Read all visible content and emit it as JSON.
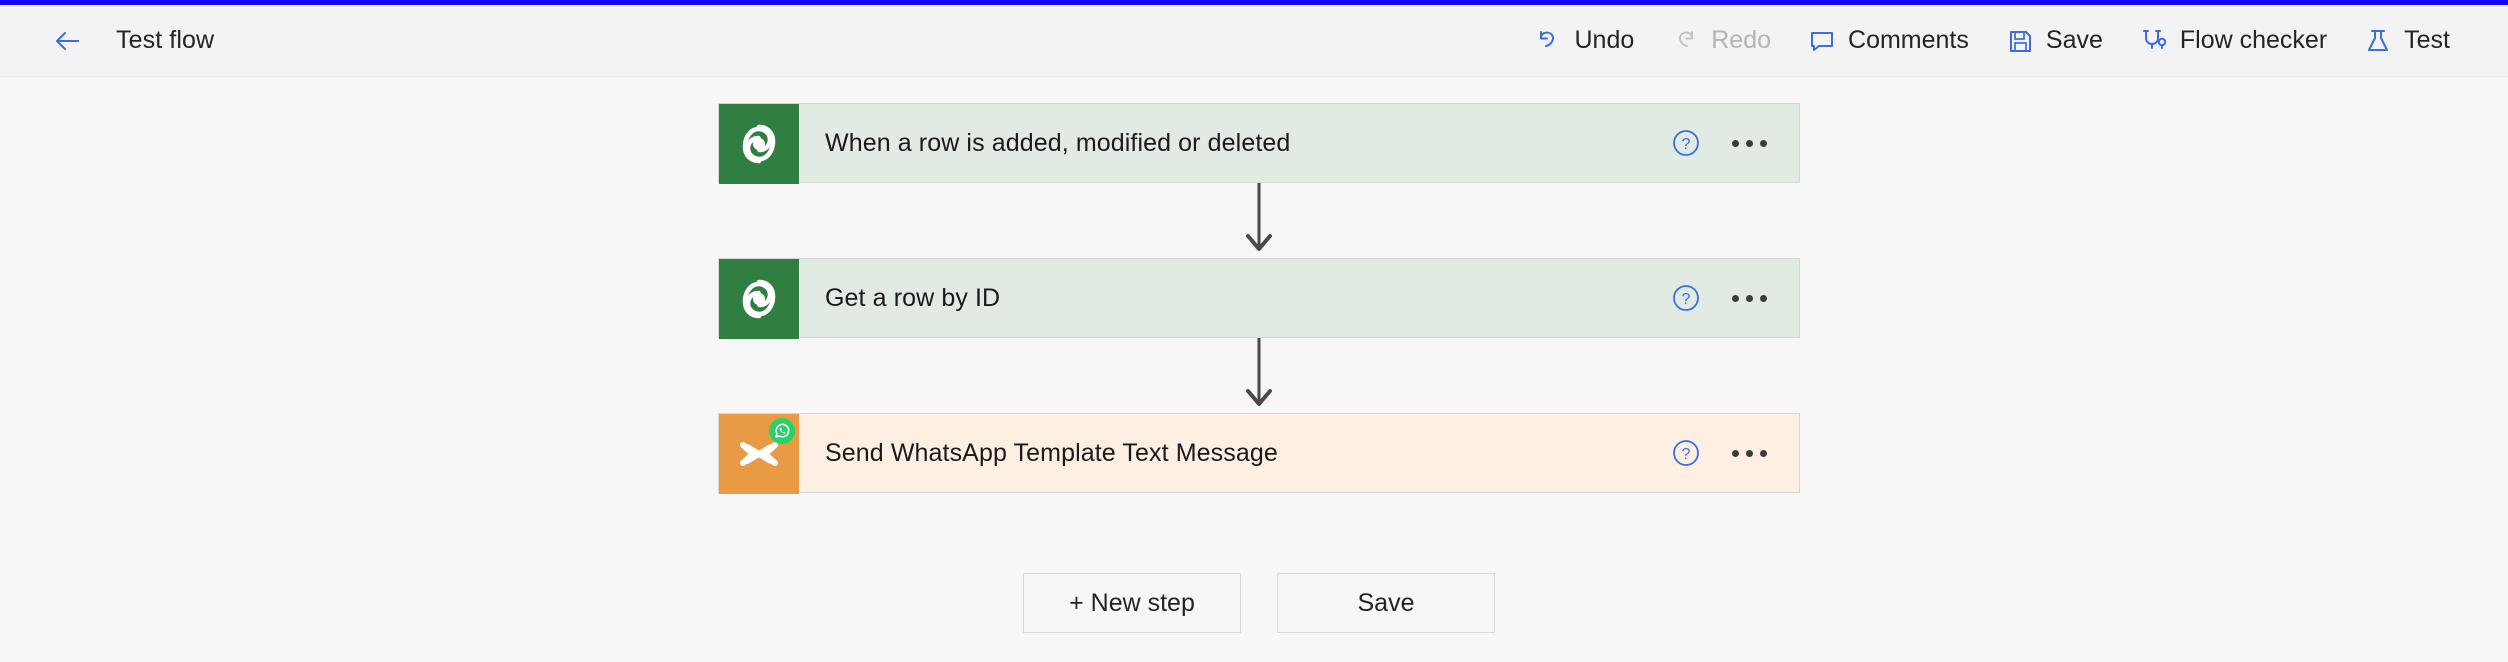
{
  "theme": {
    "accent_bar_color": "#1500FF",
    "link_blue": "#3B6DE0",
    "command_bar_bg": "#F3F3F3",
    "canvas_bg": "#F7F7F7",
    "dataverse_green": "#317E42",
    "twilio_orange": "#E89B44",
    "green_card_bg": "#E1EBE3",
    "cream_card_bg": "#FDF0E3",
    "whatsapp_green": "#25D366"
  },
  "command_bar": {
    "back_icon": "arrow-left-icon",
    "title": "Test flow",
    "items": [
      {
        "label": "Undo",
        "icon": "undo-icon",
        "disabled": false
      },
      {
        "label": "Redo",
        "icon": "redo-icon",
        "disabled": true
      },
      {
        "label": "Comments",
        "icon": "comment-icon",
        "disabled": false
      },
      {
        "label": "Save",
        "icon": "save-icon",
        "disabled": false
      },
      {
        "label": "Flow checker",
        "icon": "stethoscope-icon",
        "disabled": false
      },
      {
        "label": "Test",
        "icon": "flask-icon",
        "disabled": false
      }
    ]
  },
  "flow": {
    "steps": [
      {
        "label": "When a row is added, modified or deleted",
        "icon": "dataverse-icon",
        "connector": "Microsoft Dataverse",
        "card_style": "green",
        "help_icon": "help-circle-icon",
        "more_icon": "more-horizontal-icon"
      },
      {
        "label": "Get a row by ID",
        "icon": "dataverse-icon",
        "connector": "Microsoft Dataverse",
        "card_style": "green",
        "help_icon": "help-circle-icon",
        "more_icon": "more-horizontal-icon"
      },
      {
        "label": "Send WhatsApp Template Text Message",
        "icon": "twilio-icon",
        "badge_icon": "whatsapp-icon",
        "connector": "Twilio",
        "card_style": "cream",
        "help_icon": "help-circle-icon",
        "more_icon": "more-horizontal-icon"
      }
    ],
    "arrow_icon": "arrow-down-icon"
  },
  "bottom_bar": {
    "new_step_label": "+ New step",
    "save_label": "Save"
  }
}
